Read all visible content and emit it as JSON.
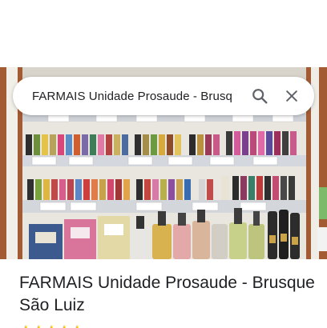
{
  "search": {
    "query": "FARMAIS Unidade Prosaude - Brusq",
    "search_icon": "search-icon",
    "close_icon": "close-icon"
  },
  "place": {
    "name": "FARMAIS Unidade Prosaude - Brusque São Luiz",
    "photo": "store-shelves-photo"
  },
  "colors": {
    "text_primary": "#202124",
    "icon": "#5f6368",
    "shelf_wood": "#a0522d"
  }
}
